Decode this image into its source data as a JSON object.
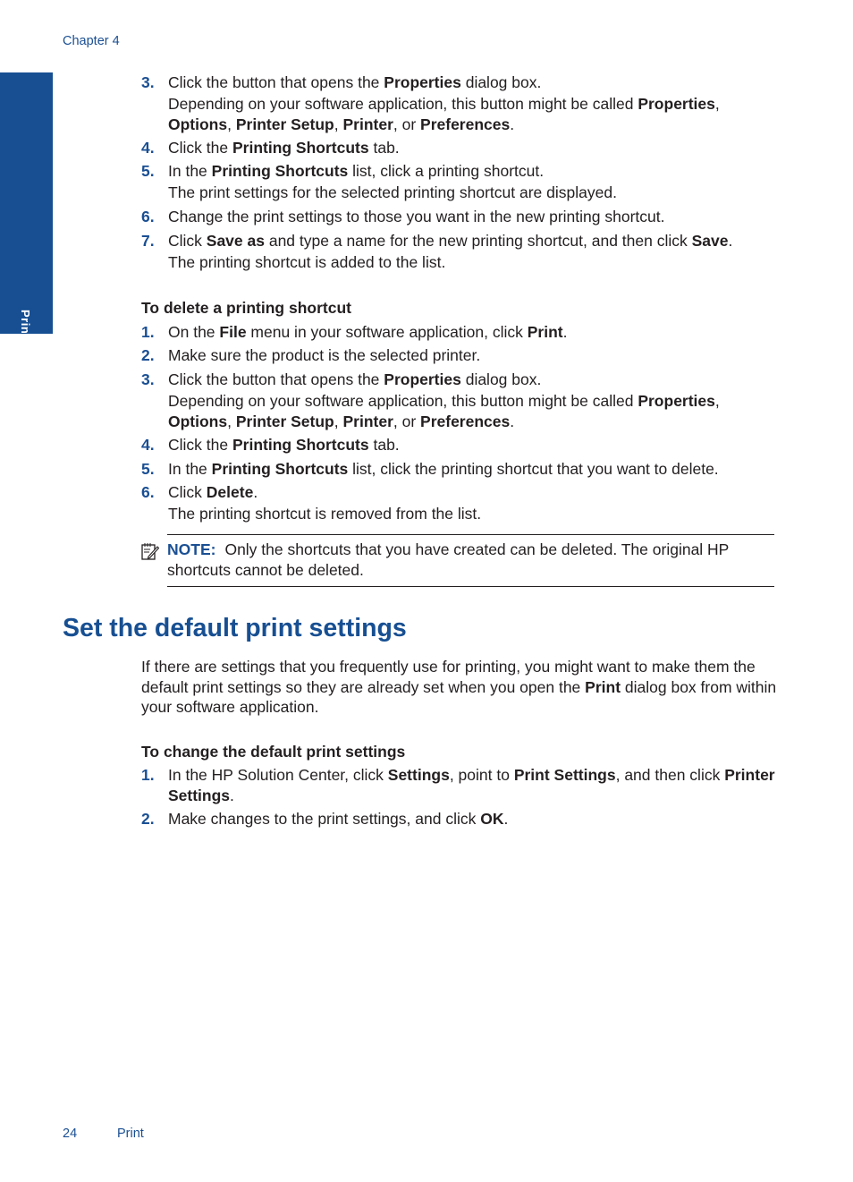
{
  "header": {
    "chapter": "Chapter 4"
  },
  "side_tab": {
    "label": "Print",
    "color": "#174f92"
  },
  "create_steps": [
    {
      "num": "3.",
      "parts": [
        [
          "Click the button that opens the ",
          false
        ],
        [
          "Properties",
          true
        ],
        [
          " dialog box.",
          false
        ]
      ],
      "extra": [
        [
          "Depending on your software application, this button might be called ",
          false
        ],
        [
          "Properties",
          true
        ],
        [
          ", ",
          false
        ],
        [
          "Options",
          true
        ],
        [
          ", ",
          false
        ],
        [
          "Printer Setup",
          true
        ],
        [
          ", ",
          false
        ],
        [
          "Printer",
          true
        ],
        [
          ", or ",
          false
        ],
        [
          "Preferences",
          true
        ],
        [
          ".",
          false
        ]
      ]
    },
    {
      "num": "4.",
      "parts": [
        [
          "Click the ",
          false
        ],
        [
          "Printing Shortcuts",
          true
        ],
        [
          " tab.",
          false
        ]
      ]
    },
    {
      "num": "5.",
      "parts": [
        [
          "In the ",
          false
        ],
        [
          "Printing Shortcuts",
          true
        ],
        [
          " list, click a printing shortcut.",
          false
        ]
      ],
      "extra": [
        [
          "The print settings for the selected printing shortcut are displayed.",
          false
        ]
      ]
    },
    {
      "num": "6.",
      "parts": [
        [
          "Change the print settings to those you want in the new printing shortcut.",
          false
        ]
      ]
    },
    {
      "num": "7.",
      "parts": [
        [
          "Click ",
          false
        ],
        [
          "Save as",
          true
        ],
        [
          " and type a name for the new printing shortcut, and then click ",
          false
        ],
        [
          "Save",
          true
        ],
        [
          ".",
          false
        ]
      ],
      "extra": [
        [
          "The printing shortcut is added to the list.",
          false
        ]
      ]
    }
  ],
  "delete_section": {
    "title": "To delete a printing shortcut",
    "steps": [
      {
        "num": "1.",
        "parts": [
          [
            "On the ",
            false
          ],
          [
            "File",
            true
          ],
          [
            " menu in your software application, click ",
            false
          ],
          [
            "Print",
            true
          ],
          [
            ".",
            false
          ]
        ]
      },
      {
        "num": "2.",
        "parts": [
          [
            "Make sure the product is the selected printer.",
            false
          ]
        ]
      },
      {
        "num": "3.",
        "parts": [
          [
            "Click the button that opens the ",
            false
          ],
          [
            "Properties",
            true
          ],
          [
            " dialog box.",
            false
          ]
        ],
        "extra": [
          [
            "Depending on your software application, this button might be called ",
            false
          ],
          [
            "Properties",
            true
          ],
          [
            ", ",
            false
          ],
          [
            "Options",
            true
          ],
          [
            ", ",
            false
          ],
          [
            "Printer Setup",
            true
          ],
          [
            ", ",
            false
          ],
          [
            "Printer",
            true
          ],
          [
            ", or ",
            false
          ],
          [
            "Preferences",
            true
          ],
          [
            ".",
            false
          ]
        ]
      },
      {
        "num": "4.",
        "parts": [
          [
            "Click the ",
            false
          ],
          [
            "Printing Shortcuts",
            true
          ],
          [
            " tab.",
            false
          ]
        ]
      },
      {
        "num": "5.",
        "parts": [
          [
            "In the ",
            false
          ],
          [
            "Printing Shortcuts",
            true
          ],
          [
            " list, click the printing shortcut that you want to delete.",
            false
          ]
        ]
      },
      {
        "num": "6.",
        "parts": [
          [
            "Click ",
            false
          ],
          [
            "Delete",
            true
          ],
          [
            ".",
            false
          ]
        ],
        "extra": [
          [
            "The printing shortcut is removed from the list.",
            false
          ]
        ]
      }
    ]
  },
  "note": {
    "icon": "note-pencil-icon",
    "label": "NOTE:",
    "text": "Only the shortcuts that you have created can be deleted. The original HP shortcuts cannot be deleted."
  },
  "default_section": {
    "heading": "Set the default print settings",
    "intro": [
      [
        "If there are settings that you frequently use for printing, you might want to make them the default print settings so they are already set when you open the ",
        false
      ],
      [
        "Print",
        true
      ],
      [
        " dialog box from within your software application.",
        false
      ]
    ],
    "subheading": "To change the default print settings",
    "steps": [
      {
        "num": "1.",
        "parts": [
          [
            "In the HP Solution Center, click ",
            false
          ],
          [
            "Settings",
            true
          ],
          [
            ", point to ",
            false
          ],
          [
            "Print Settings",
            true
          ],
          [
            ", and then click ",
            false
          ],
          [
            "Printer Settings",
            true
          ],
          [
            ".",
            false
          ]
        ]
      },
      {
        "num": "2.",
        "parts": [
          [
            "Make changes to the print settings, and click ",
            false
          ],
          [
            "OK",
            true
          ],
          [
            ".",
            false
          ]
        ]
      }
    ]
  },
  "footer": {
    "page_number": "24",
    "section": "Print"
  }
}
